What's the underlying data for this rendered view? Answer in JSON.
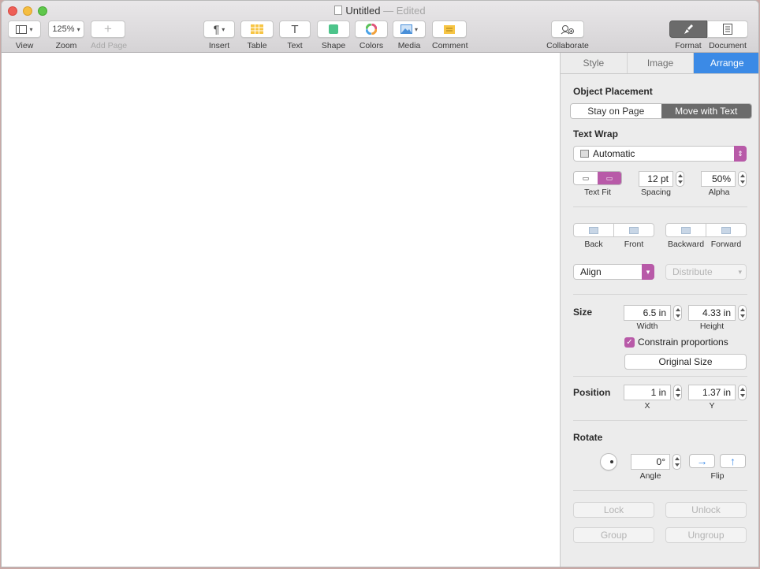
{
  "window": {
    "title": "Untitled",
    "status": "— Edited"
  },
  "toolbar": {
    "view": "View",
    "zoom_value": "125%",
    "zoom": "Zoom",
    "add_page": "Add Page",
    "insert": "Insert",
    "table": "Table",
    "text": "Text",
    "shape": "Shape",
    "colors": "Colors",
    "media": "Media",
    "comment": "Comment",
    "collaborate": "Collaborate",
    "format": "Format",
    "document": "Document"
  },
  "inspector": {
    "tabs": [
      "Style",
      "Image",
      "Arrange"
    ],
    "active_tab": "Arrange",
    "object_placement": {
      "heading": "Object Placement",
      "options": [
        "Stay on Page",
        "Move with Text"
      ],
      "selected": "Move with Text"
    },
    "text_wrap": {
      "heading": "Text Wrap",
      "value": "Automatic",
      "text_fit_label": "Text Fit",
      "spacing_value": "12 pt",
      "spacing_label": "Spacing",
      "alpha_value": "50%",
      "alpha_label": "Alpha"
    },
    "order": {
      "back": "Back",
      "front": "Front",
      "backward": "Backward",
      "forward": "Forward"
    },
    "align": {
      "align_value": "Align",
      "distribute_value": "Distribute"
    },
    "size": {
      "heading": "Size",
      "width_value": "6.5 in",
      "width_label": "Width",
      "height_value": "4.33 in",
      "height_label": "Height",
      "constrain": "Constrain proportions",
      "constrain_checked": true,
      "original_size": "Original Size"
    },
    "position": {
      "heading": "Position",
      "x_value": "1 in",
      "x_label": "X",
      "y_value": "1.37 in",
      "y_label": "Y"
    },
    "rotate": {
      "heading": "Rotate",
      "angle_value": "0°",
      "angle_label": "Angle",
      "flip_label": "Flip"
    },
    "lock": {
      "lock": "Lock",
      "unlock": "Unlock",
      "group": "Group",
      "ungroup": "Ungroup"
    }
  },
  "colors": {
    "accent": "#3b8ae6",
    "pink": "#b85aa8"
  }
}
